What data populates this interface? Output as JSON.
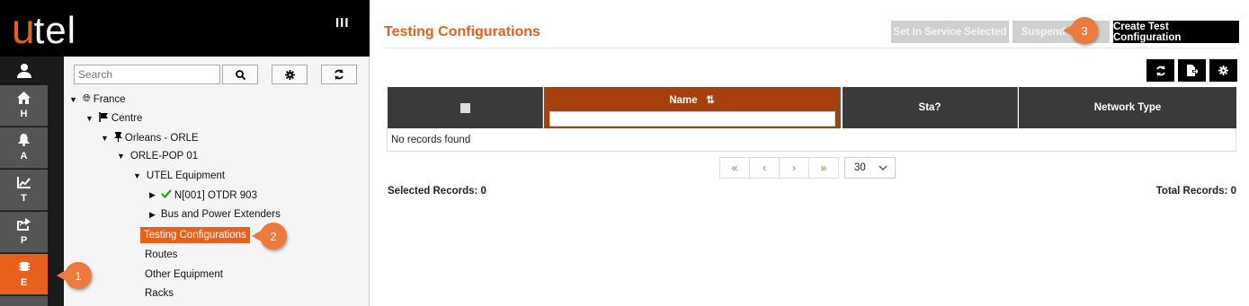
{
  "brand": {
    "logo_first": "u",
    "logo_rest": "tel"
  },
  "topbar": {
    "menu_toggle": "III"
  },
  "rail": {
    "items": [
      {
        "letter": "H",
        "icon": "home-icon"
      },
      {
        "letter": "A",
        "icon": "bell-icon"
      },
      {
        "letter": "T",
        "icon": "chart-icon"
      },
      {
        "letter": "P",
        "icon": "share-icon"
      },
      {
        "letter": "E",
        "icon": "chip-icon",
        "active": true
      }
    ]
  },
  "tree": {
    "search_placeholder": "Search",
    "nodes": [
      {
        "label": "France"
      },
      {
        "label": "Centre"
      },
      {
        "label": "Orleans - ORLE"
      },
      {
        "label": "ORLE-POP 01"
      },
      {
        "label": "UTEL Equipment"
      },
      {
        "label": "N[001] OTDR 903"
      },
      {
        "label": "Bus and Power Extenders"
      },
      {
        "label": "Testing Configurations",
        "selected": true
      },
      {
        "label": "Routes"
      },
      {
        "label": "Other Equipment"
      },
      {
        "label": "Racks"
      }
    ]
  },
  "main": {
    "title": "Testing Configurations",
    "buttons": {
      "set_in_service": "Set In Service Selected",
      "suspend": "Suspend S",
      "create": "Create Test Configuration"
    },
    "grid": {
      "columns": [
        "",
        "Name",
        "Sta?",
        "Network Type"
      ],
      "sort_indicator": "⇅",
      "empty_message": "No records found"
    },
    "pager": {
      "first": "«",
      "prev": "‹",
      "next": "›",
      "last": "»",
      "page_size": "30"
    },
    "footer": {
      "selected": "Selected Records: 0",
      "total": "Total Records: 0"
    }
  },
  "callouts": [
    "1",
    "2",
    "3"
  ],
  "colors": {
    "accent": "#e8601c",
    "header_active": "#a6400d",
    "rail": "#555555"
  }
}
